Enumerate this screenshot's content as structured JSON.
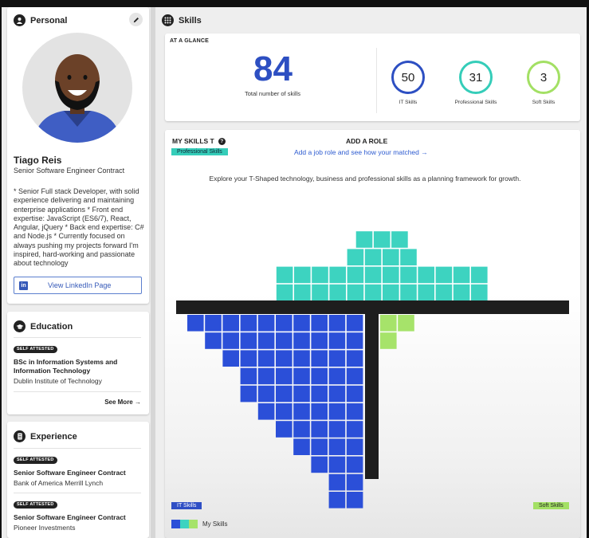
{
  "personal": {
    "header": "Personal",
    "name": "Tiago Reis",
    "title": "Senior Software Engineer Contract",
    "bio": "* Senior Full stack Developer, with solid experience delivering and maintaining enterprise applications * Front end expertise: JavaScript (ES6/7), React, Angular, jQuery * Back end expertise: C# and Node.js * Currently focused on always pushing my projects forward I'm inspired, hard-working and passionate about technology",
    "linkedin_label": "View LinkedIn Page",
    "linkedin_icon_text": "in"
  },
  "education": {
    "header": "Education",
    "badge": "SELF ATTESTED",
    "degree": "BSc in Information Systems and Information Technology",
    "school": "Dublin Institute of Technology",
    "see_more": "See More"
  },
  "experience": {
    "header": "Experience",
    "items": [
      {
        "badge": "SELF ATTESTED",
        "role": "Senior Software Engineer Contract",
        "company": "Bank of America Merrill Lynch"
      },
      {
        "badge": "SELF ATTESTED",
        "role": "Senior Software Engineer Contract",
        "company": "Pioneer Investments"
      }
    ]
  },
  "skills": {
    "header": "Skills",
    "at_a_glance": "AT A GLANCE",
    "total": "84",
    "total_label": "Total number of skills",
    "stats": [
      {
        "value": "50",
        "label": "IT Skills",
        "color": "#2d4fc2"
      },
      {
        "value": "31",
        "label": "Professional Skills",
        "color": "#35cdb9"
      },
      {
        "value": "3",
        "label": "Soft Skills",
        "color": "#a3e064"
      }
    ]
  },
  "tshape": {
    "title": "MY SKILLS T",
    "professional_tag": "Professional Skills",
    "add_role_title": "ADD A ROLE",
    "add_role_link": "Add a job role and see how your matched",
    "explore": "Explore your T-Shaped technology, business and professional skills as a planning framework for growth.",
    "it_tag": "IT Skills",
    "soft_tag": "Soft Skills",
    "legend_label": "My Skills",
    "colors": {
      "it": "#2b4fd8",
      "professional": "#3dd3c0",
      "soft": "#a6e36a",
      "bar": "#1e1e1e"
    },
    "professional_rows": [
      3,
      4,
      12,
      12
    ],
    "it_rows": [
      10,
      9,
      8,
      7,
      7,
      6,
      5,
      4,
      3,
      2,
      2
    ],
    "soft_rows": [
      2,
      1
    ]
  }
}
